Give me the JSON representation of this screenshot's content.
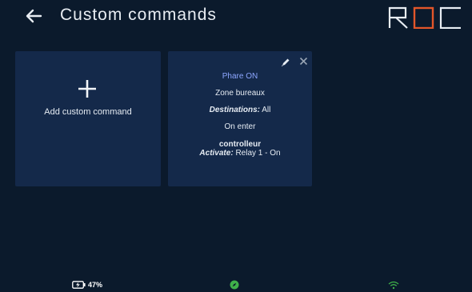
{
  "header": {
    "title": "Custom commands",
    "logo_text": "ROC",
    "back_icon": "arrow-left-icon"
  },
  "add_card": {
    "label": "Add custom command",
    "icon": "plus-icon"
  },
  "command_card": {
    "name": "Phare ON",
    "zone": "Zone bureaux",
    "destinations_label": "Destinations:",
    "destinations_value": "All",
    "trigger": "On enter",
    "controller": "controlleur",
    "activate_label": "Activate:",
    "activate_value": "Relay 1 - On",
    "edit_icon": "pencil-icon",
    "delete_icon": "close-icon"
  },
  "status_bar": {
    "battery_percent": "47%",
    "battery_icon": "battery-charging-icon",
    "center_icon": "compass-icon",
    "wifi_icon": "wifi-icon"
  },
  "colors": {
    "background": "#0b1a2c",
    "card": "#14294a",
    "accent": "#8da6ff",
    "logo_orange": "#e3562a",
    "status_green": "#3fb04a"
  }
}
